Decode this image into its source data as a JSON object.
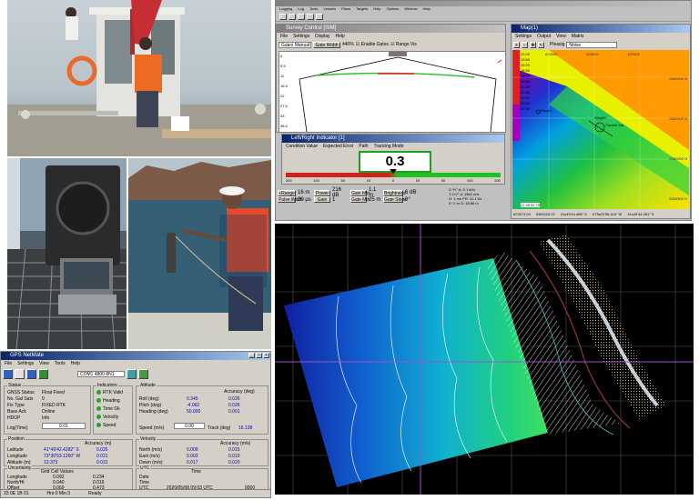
{
  "boat_window": {
    "title": "Survey Control [SIM]",
    "menu": [
      "File",
      "Settings",
      "Display",
      "Help"
    ],
    "mode": "Gates Manual",
    "zoom": "440%",
    "btn_gate_width": "Gate Width",
    "chk_enable_gates": "Enable Gates",
    "chk_range_vis": "Range Vis",
    "depth_ticks": [
      "0",
      "5.5",
      "11",
      "16.5",
      "22",
      "27.5",
      "33",
      "38.5"
    ]
  },
  "sonar_window": {
    "title": "Survey Control",
    "menu": [
      "Logging",
      "Log",
      "Tools",
      "Vessels",
      "Plans",
      "Targets",
      "Help",
      "Options",
      "Window",
      "Help"
    ]
  },
  "indicator_window": {
    "title": "Left/Right Indicator [1]",
    "menu": [
      "Condition Value",
      "Expected Error",
      "Path",
      "Tracking Mode"
    ],
    "value": "0.3",
    "scale": [
      "200",
      "100",
      "50",
      "20",
      "0",
      "20",
      "50",
      "100",
      "200"
    ]
  },
  "controls": {
    "row1": [
      {
        "btn": "+Range",
        "val": "16 m"
      },
      {
        "btn": "Power",
        "val": "216 dB"
      },
      {
        "btn": "Gain Min",
        "val": "1.1 m"
      },
      {
        "btn": "Brightness",
        "val": "6 dB"
      }
    ],
    "row2": [
      {
        "btn": "Pulse Width",
        "val": "20 µs"
      },
      {
        "btn": "Gain",
        "val": "1"
      },
      {
        "btn": "Gate Min",
        "val": "25 m"
      },
      {
        "btn": "Gate Slope",
        "val": "0°"
      }
    ],
    "readout": [
      "S  *H°    A: 0.1 kHz",
      "T: 0.0°    d: 1962 m/s",
      "G: 1 ms    PR: 11.1 Hz",
      "D: 0 m    O: 16.88 m"
    ]
  },
  "map_window": {
    "title": "Map(1)",
    "menu": [
      "Settings",
      "Output",
      "View",
      "Matrix"
    ],
    "dropdown": "Noise",
    "palette": "Pleasig",
    "legend": [
      "12.00",
      "13.50",
      "15.00",
      "16.50",
      "18.00",
      "19.50",
      "21.00",
      "22.50",
      "24.00",
      "25.50",
      "27.00"
    ],
    "grid_x": [
      "623400",
      "623600",
      "623800"
    ],
    "grid_y": [
      "5360200 N",
      "5360100 N",
      "5360000 N",
      "5359900 N"
    ],
    "labels": [
      "Waypt1",
      "Waypt2",
      "Current Vsl"
    ],
    "coord_readout": "17.45  52.70",
    "status": [
      "623373.04",
      "5360115.22",
      "41s49'44.486\" S",
      "073s20'36.418\" W",
      "41s49'44.481\" S"
    ]
  },
  "gps_window": {
    "title": "GPS NetMate",
    "menu": [
      "File",
      "Settings",
      "View",
      "Tools",
      "Help"
    ],
    "device": "COM1 4800 8N1",
    "status_group": {
      "title": "Status",
      "rows": [
        [
          "GNSS Status",
          "Float Fixed"
        ],
        [
          "No. Gal Sats",
          "0"
        ],
        [
          "Fix Type",
          "FIXED RTK"
        ],
        [
          "Base Ack",
          "Online"
        ],
        [
          "HDOP",
          "Info"
        ],
        [
          "Log(Time)",
          "0.01"
        ]
      ]
    },
    "leds_group": {
      "title": "Indicators",
      "rows": [
        "RTK Valid",
        "Heading",
        "Time Ok",
        "Velocity",
        "Speed"
      ]
    },
    "attitude_group": {
      "title": "Attitude",
      "header": "Accuracy (deg)",
      "rows": [
        [
          "Roll (deg)",
          "0.345",
          "0.026"
        ],
        [
          "Pitch (deg)",
          "-4.062",
          "0.026"
        ],
        [
          "Heading (deg)",
          "50.000",
          "0.001"
        ]
      ],
      "speed_label": "Speed (m/s)",
      "speed_value": "0.00",
      "hdg_label": "Track (deg)",
      "hdg_value": "16.138"
    },
    "position_group": {
      "title": "Position",
      "header": "Accuracy (m)",
      "rows": [
        [
          "Latitude",
          "41°49'42.4282\" S",
          "0.025"
        ],
        [
          "Longitude",
          "73°30'53.1260\" W",
          "0.021"
        ],
        [
          "Altitude (m)",
          "13.373",
          "0.031"
        ]
      ]
    },
    "velocity_group": {
      "title": "Velocity",
      "header": "Accuracy (m/s)",
      "rows": [
        [
          "North (m/s)",
          "0.009",
          "0.015"
        ],
        [
          "East (m/s)",
          "0.003",
          "0.010"
        ],
        [
          "Down (m/s)",
          "0.017",
          "0.020"
        ]
      ]
    },
    "uncert_group": {
      "title": "Uncertainty",
      "header": "Grid Cell Values",
      "rows": [
        [
          "Longitude",
          "0.092",
          "0.234"
        ],
        [
          "North/Ht",
          "0.040",
          "0.016"
        ],
        [
          "Offset",
          "0.069",
          "0.473"
        ]
      ]
    },
    "gps_group": {
      "title": "UTC",
      "header": "Time",
      "rows": [
        [
          "Date",
          "",
          ""
        ],
        [
          "Time",
          "",
          ""
        ],
        [
          "UTC",
          "2020/05/08 09:03 UTC",
          "0000"
        ]
      ]
    },
    "status_bar": [
      "33 0E 1B 01",
      "Hrs:0 Min:3",
      "Ready"
    ]
  }
}
